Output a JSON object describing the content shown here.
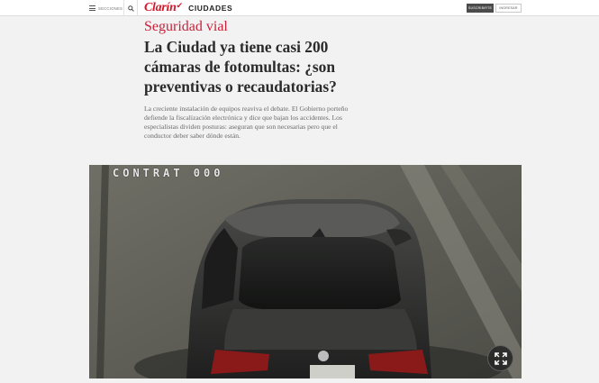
{
  "header": {
    "menu_label": "Secciones",
    "logo_text": "Clarín",
    "section": "CIUDADES",
    "subscribe_label": "Suscribirte",
    "login_label": "Ingresar",
    "accent_color": "#d8172a"
  },
  "article": {
    "kicker": "Seguridad vial",
    "headline": "La Ciudad ya tiene casi 200 cámaras de fotomultas: ¿son preventivas o recaudatorias?",
    "lead": "La creciente instalación de equipos reaviva el debate. El Gobierno porteño defiende la fiscalización electrónica y dice que bajan los accidentes. Los especialistas dividen posturas: aseguran que son necesarias pero que el conductor deber saber dónde están."
  },
  "photo": {
    "overlay_text": "CONTRAT 000"
  },
  "icons": {
    "menu": "hamburger-icon",
    "search": "search-icon",
    "expand": "expand-icon"
  }
}
